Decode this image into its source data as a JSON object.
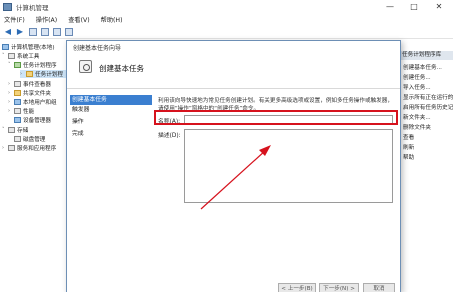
{
  "window": {
    "title": "计算机管理",
    "menu": [
      "文件(F)",
      "操作(A)",
      "查看(V)",
      "帮助(H)"
    ]
  },
  "tree": {
    "root": "计算机管理(本地)",
    "system_tools": "系统工具",
    "task_scheduler": "任务计划程序",
    "task_library": "任务计划程",
    "event_viewer": "事件查看器",
    "shared_folders": "共享文件夹",
    "local_users": "本地用户和组",
    "performance": "性能",
    "device_manager": "设备管理器",
    "storage": "存储",
    "disk_management": "磁盘管理",
    "services_apps": "服务和应用程序"
  },
  "actions": {
    "header": "任务计划程序库",
    "items": [
      "创建基本任务...",
      "创建任务...",
      "导入任务...",
      "显示所有正在运行的任务",
      "启用所有任务历史记录",
      "新文件夹...",
      "删除文件夹",
      "查看",
      "刷新",
      "帮助"
    ]
  },
  "dialog": {
    "title": "创建基本任务向导",
    "heading": "创建基本任务",
    "steps": [
      "创建基本任务",
      "触发器",
      "操作",
      "完成"
    ],
    "description": "利用该向导快速地为常见任务创建计划。有关更多高级选项或设置，例如多任务操作或触发器，请使用“操作”窗格中的“创建任务”命令。",
    "name_label": "名称(A):",
    "name_value": "",
    "desc_label": "描述(D):",
    "desc_value": "",
    "buttons": [
      "< 上一步(B)",
      "下一步(N) >",
      "取消"
    ]
  },
  "colors": {
    "highlight": "#d6121d",
    "step_active": "#3b7fd0"
  }
}
